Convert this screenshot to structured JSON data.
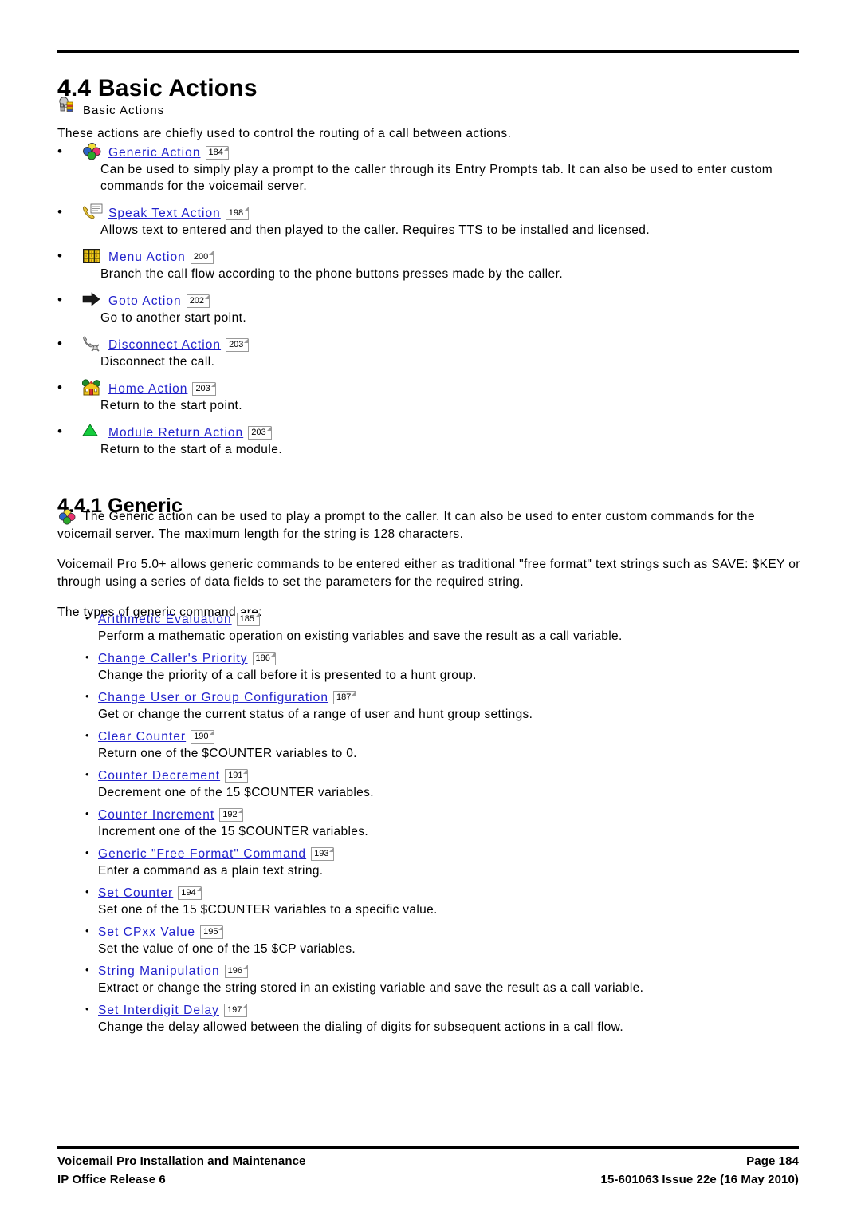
{
  "document": {
    "chapter_title": "4.4 Basic Actions",
    "intro_icon_label": "Basic Actions",
    "intro_paragraph": "These actions are chiefly used to control the routing of a call between actions.",
    "bullet_glyph": "•",
    "link_color": "#2222cc"
  },
  "basic_actions": [
    {
      "icon": "generic-action-icon",
      "link": "Generic Action",
      "page_ref": "184",
      "description": "Can be used to simply play a prompt to the caller through its Entry Prompts tab. It can also be used to enter custom commands for the voicemail server."
    },
    {
      "icon": "speak-text-action-icon",
      "link": "Speak Text Action",
      "page_ref": "198",
      "description": "Allows text to entered and then played to the caller. Requires TTS to be installed and licensed."
    },
    {
      "icon": "menu-action-icon",
      "link": "Menu Action",
      "page_ref": "200",
      "description": "Branch the call flow according to the phone buttons presses made by the caller."
    },
    {
      "icon": "goto-action-icon",
      "link": "Goto Action",
      "page_ref": "202",
      "description": "Go to another start point."
    },
    {
      "icon": "disconnect-action-icon",
      "link": "Disconnect Action",
      "page_ref": "203",
      "description": "Disconnect the call."
    },
    {
      "icon": "home-action-icon",
      "link": "Home Action",
      "page_ref": "203",
      "description": "Return to the start point."
    },
    {
      "icon": "module-return-action-icon",
      "link": "Module Return Action",
      "page_ref": "203",
      "description": "Return to the start of a module."
    }
  ],
  "generic_section": {
    "sub_title": "4.4.1 Generic",
    "paragraph_1": "The Generic action can be used to play a prompt to the caller. It can also be used to enter custom commands for the voicemail server. The maximum length for the string is 128 characters.",
    "paragraph_2": "Voicemail Pro 5.0+ allows generic commands to be entered either as traditional \"free format\" text strings such as SAVE: $KEY or through using a series of data fields to set the parameters for the required string.",
    "paragraph_3": "The types of generic command are:"
  },
  "generic_commands": [
    {
      "link": "Arithmetic Evaluation",
      "page_ref": "185",
      "description": "Perform a mathematic operation on existing variables and save the result as a call variable."
    },
    {
      "link": "Change Caller's Priority",
      "page_ref": "186",
      "description": "Change the priority of a call before it is presented to a hunt group."
    },
    {
      "link": "Change User or Group Configuration",
      "page_ref": "187",
      "description": "Get or change the current status of a range of user and hunt group settings."
    },
    {
      "link": "Clear Counter",
      "page_ref": "190",
      "description": "Return one of the $COUNTER variables to 0."
    },
    {
      "link": "Counter Decrement",
      "page_ref": "191",
      "description": "Decrement one of the 15 $COUNTER variables."
    },
    {
      "link": "Counter Increment",
      "page_ref": "192",
      "description": "Increment one of the 15 $COUNTER variables."
    },
    {
      "link": "Generic \"Free Format\" Command",
      "page_ref": "193",
      "description": "Enter a command as a plain text string."
    },
    {
      "link": "Set Counter",
      "page_ref": "194",
      "description": "Set one of the 15 $COUNTER variables to a specific value."
    },
    {
      "link": "Set CPxx Value",
      "page_ref": "195",
      "description": "Set the value of one of the 15 $CP variables."
    },
    {
      "link": "String Manipulation",
      "page_ref": "196",
      "description": "Extract or change the string stored in an existing variable and save the result as a call variable."
    },
    {
      "link": "Set Interdigit Delay",
      "page_ref": "197",
      "description": "Change the delay allowed between the dialing of digits for subsequent actions in a call flow."
    }
  ],
  "footer": {
    "left_line_1": "Voicemail Pro Installation and Maintenance",
    "left_line_2": "IP Office Release 6",
    "right_line_1": "Page 184",
    "right_line_2": "15-601063 Issue 22e (16 May 2010)"
  }
}
